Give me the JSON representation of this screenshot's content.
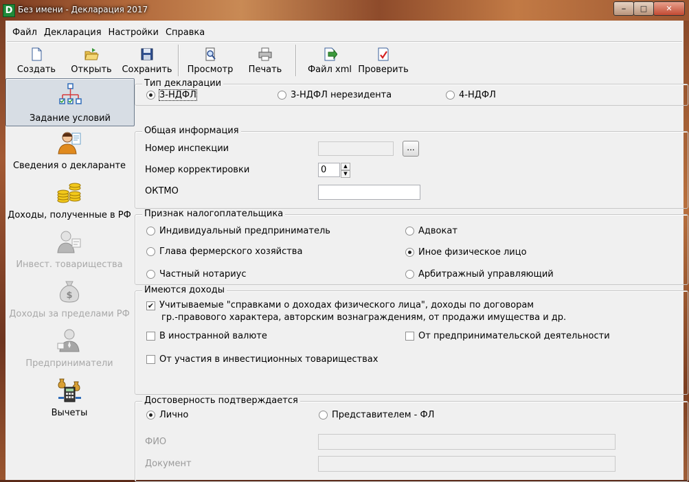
{
  "window": {
    "title": "Без имени - Декларация 2017",
    "app_icon_letter": "D"
  },
  "menu": [
    "Файл",
    "Декларация",
    "Настройки",
    "Справка"
  ],
  "toolbar": {
    "create": "Создать",
    "open": "Открыть",
    "save": "Сохранить",
    "preview": "Просмотр",
    "print": "Печать",
    "xml": "Файл xml",
    "check": "Проверить"
  },
  "sidebar": {
    "items": [
      {
        "label": "Задание условий",
        "icon": "hierarchy-icon",
        "state": "active"
      },
      {
        "label": "Сведения о декларанте",
        "icon": "person-icon",
        "state": "normal"
      },
      {
        "label": "Доходы, полученные в РФ",
        "icon": "coins-icon",
        "state": "normal"
      },
      {
        "label": "Инвест. товарищества",
        "icon": "investors-icon",
        "state": "disabled"
      },
      {
        "label": "Доходы за пределами РФ",
        "icon": "money-bag-icon",
        "state": "disabled"
      },
      {
        "label": "Предприниматели",
        "icon": "businessman-icon",
        "state": "disabled"
      },
      {
        "label": "Вычеты",
        "icon": "calculator-icon",
        "state": "normal"
      }
    ]
  },
  "decl_type": {
    "title": "Тип декларации",
    "options": [
      "3-НДФЛ",
      "3-НДФЛ нерезидента",
      "4-НДФЛ"
    ],
    "selected": "3-НДФЛ"
  },
  "general": {
    "title": "Общая информация",
    "inspection_label": "Номер инспекции",
    "inspection_value": "",
    "browse_label": "...",
    "correction_label": "Номер корректировки",
    "correction_value": "0",
    "oktmo_label": "ОКТМО",
    "oktmo_value": ""
  },
  "taxpayer": {
    "title": "Признак налогоплательщика",
    "options": [
      "Индивидуальный предприниматель",
      "Адвокат",
      "Глава фермерского хозяйства",
      "Иное физическое лицо",
      "Частный нотариус",
      "Арбитражный управляющий"
    ],
    "selected": "Иное физическое лицо"
  },
  "income": {
    "title": "Имеются доходы",
    "main_line1": "Учитываемые \"справками о доходах физического лица\", доходы по договорам",
    "main_line2": "гр.-правового характера, авторским вознаграждениям, от продажи имущества и др.",
    "main_checked": true,
    "foreign_currency": "В иностранной валюте",
    "entrepreneur": "От предпринимательской деятельности",
    "investment": "От участия в инвестиционных товариществах",
    "check_mark": "✔"
  },
  "confirm": {
    "title": "Достоверность подтверждается",
    "personal": "Лично",
    "representative": "Представителем - ФЛ",
    "selected": "Лично",
    "fio_label": "ФИО",
    "doc_label": "Документ",
    "fio_value": "",
    "doc_value": ""
  },
  "colors": {
    "active_nav": "#d7dde4",
    "panel_bg": "#f0f0f0"
  }
}
